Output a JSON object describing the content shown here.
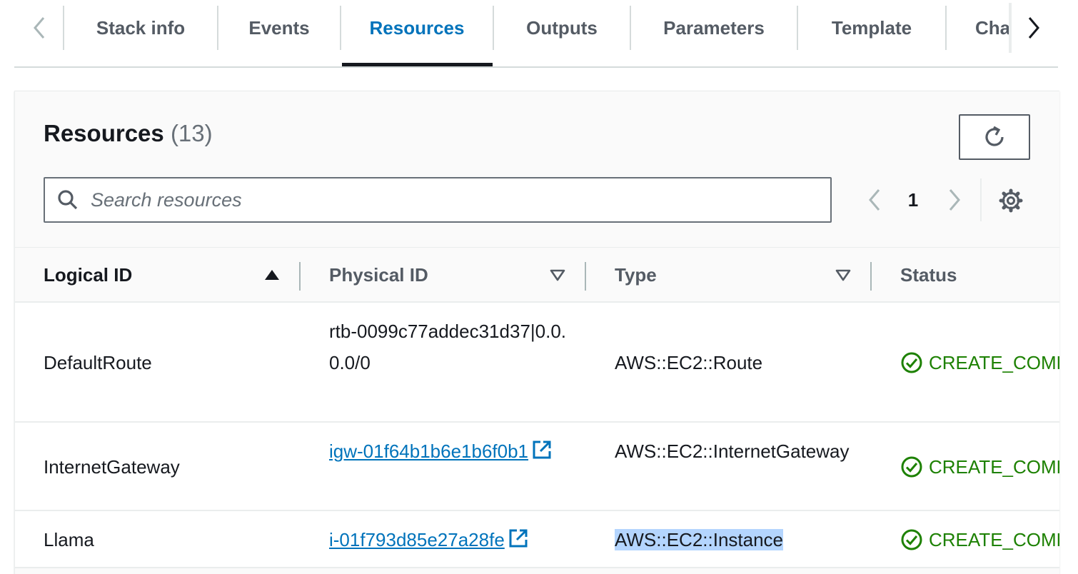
{
  "tabs": {
    "items": [
      {
        "label": "Stack info"
      },
      {
        "label": "Events"
      },
      {
        "label": "Resources"
      },
      {
        "label": "Outputs"
      },
      {
        "label": "Parameters"
      },
      {
        "label": "Template"
      },
      {
        "label": "Cha"
      }
    ],
    "active": "Resources"
  },
  "panel": {
    "title": "Resources",
    "count": "(13)",
    "search_placeholder": "Search resources",
    "page_number": "1"
  },
  "table": {
    "columns": [
      {
        "label": "Logical ID",
        "sort": "ascending"
      },
      {
        "label": "Physical ID",
        "sort": "none"
      },
      {
        "label": "Type",
        "sort": "none"
      },
      {
        "label": "Status",
        "sort": "none"
      }
    ],
    "rows": [
      {
        "logical_id": "DefaultRoute",
        "physical_id": "rtb-0099c77addec31d37|0.0.0.0/0",
        "physical_link": false,
        "type": "AWS::EC2::Route",
        "status": "CREATE_COMPLETE"
      },
      {
        "logical_id": "InternetGateway",
        "physical_id": "igw-01f64b1b6e1b6f0b1",
        "physical_link": true,
        "type": "AWS::EC2::InternetGateway",
        "status": "CREATE_COMPLETE"
      },
      {
        "logical_id": "Llama",
        "physical_id": "i-01f793d85e27a28fe",
        "physical_link": true,
        "type": "AWS::EC2::Instance",
        "type_selected": true,
        "status": "CREATE_COMPLETE"
      }
    ]
  },
  "colors": {
    "accent": "#0073bb",
    "success": "#1d8102",
    "text": "#16191f",
    "muted": "#545b64",
    "selection": "#b4d5fe"
  },
  "icons": {
    "tab_prev": "chevron-left-icon",
    "tab_next": "chevron-right-icon",
    "refresh": "refresh-icon",
    "search": "search-icon",
    "settings": "gear-icon",
    "external_link": "external-link-icon",
    "status_ok": "check-circle-icon",
    "sort_ascending": "caret-up-filled-icon",
    "sort_none": "caret-down-outline-icon"
  }
}
